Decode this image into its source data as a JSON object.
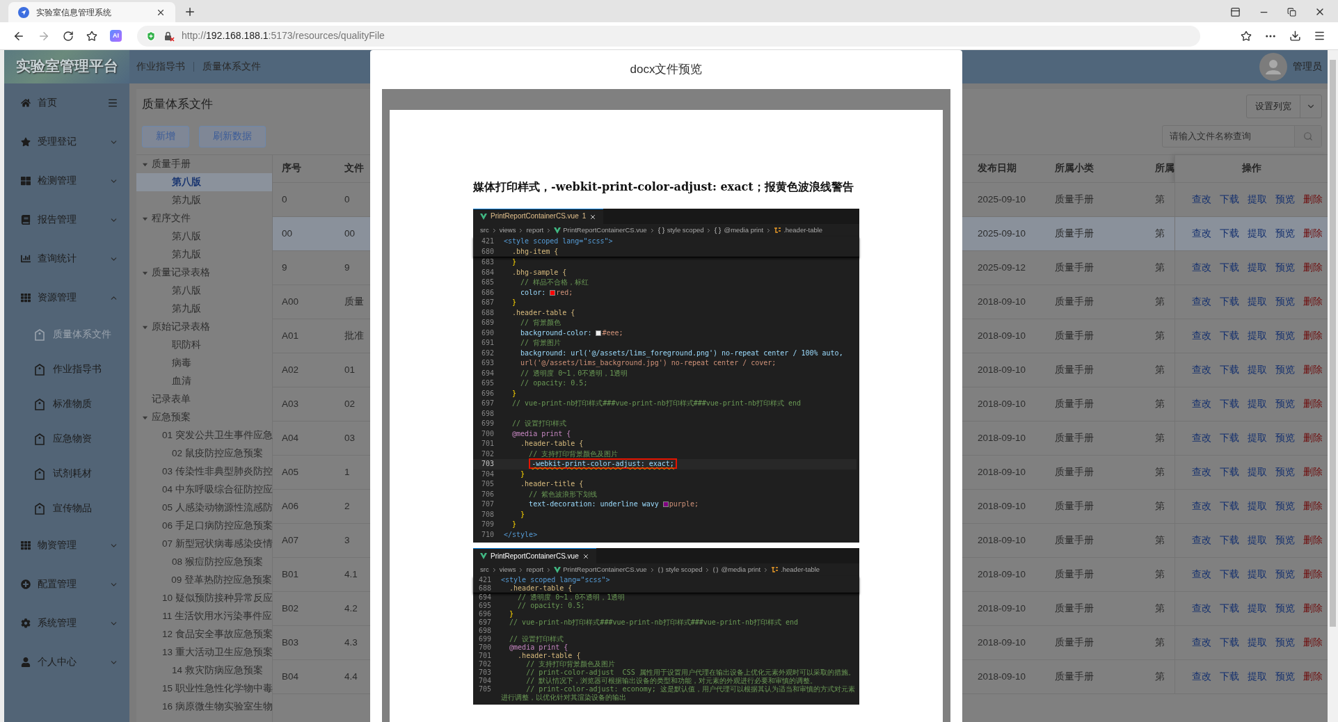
{
  "browser": {
    "tab": {
      "title": "实验室信息管理系统"
    },
    "address": {
      "scheme": "http://",
      "host": "192.168.188.1",
      "path": ":5173/resources/qualityFile"
    },
    "ai_label": "AI"
  },
  "header": {
    "logo": "实验室管理平台",
    "breadcrumb": [
      "作业指导书",
      "质量体系文件"
    ],
    "user": "管理员"
  },
  "sidebar": {
    "items": [
      {
        "label": "首页",
        "selected": false
      },
      {
        "label": "受理登记",
        "selected": false,
        "expanded": false
      },
      {
        "label": "检测管理",
        "selected": false,
        "expanded": false
      },
      {
        "label": "报告管理",
        "selected": false,
        "expanded": false
      },
      {
        "label": "查询统计",
        "selected": false,
        "expanded": false
      },
      {
        "label": "资源管理",
        "selected": false,
        "expanded": true,
        "children": [
          {
            "label": "质量体系文件",
            "selected": true
          },
          {
            "label": "作业指导书",
            "selected": false
          },
          {
            "label": "标准物质",
            "selected": false
          },
          {
            "label": "应急物资",
            "selected": false
          },
          {
            "label": "试剂耗材",
            "selected": false
          },
          {
            "label": "宣传物品",
            "selected": false
          }
        ]
      },
      {
        "label": "物资管理",
        "selected": false,
        "expanded": false
      },
      {
        "label": "配置管理",
        "selected": false,
        "expanded": false
      },
      {
        "label": "系统管理",
        "selected": false,
        "expanded": false
      },
      {
        "label": "个人中心",
        "selected": false,
        "expanded": false
      }
    ]
  },
  "page": {
    "title": "质量体系文件",
    "buttons": [
      "新增",
      "刷新数据"
    ],
    "column_button": "设置列宽",
    "search": {
      "placeholder": "请输入文件名称查询"
    }
  },
  "tree": [
    {
      "label": "质量手册",
      "selected": false,
      "expanded": true,
      "children": [
        {
          "label": "第八版",
          "selected": true
        },
        {
          "label": "第九版",
          "selected": false
        }
      ]
    },
    {
      "label": "程序文件",
      "selected": false,
      "expanded": true,
      "children": [
        {
          "label": "第八版",
          "selected": false
        },
        {
          "label": "第九版",
          "selected": false
        }
      ]
    },
    {
      "label": "质量记录表格",
      "selected": false,
      "expanded": true,
      "children": [
        {
          "label": "第八版",
          "selected": false
        },
        {
          "label": "第九版",
          "selected": false
        }
      ]
    },
    {
      "label": "原始记录表格",
      "selected": false,
      "expanded": true,
      "children": [
        {
          "label": "职防科",
          "selected": false
        },
        {
          "label": "病毒",
          "selected": false
        },
        {
          "label": "血清",
          "selected": false
        }
      ]
    },
    {
      "label": "记录表单",
      "selected": false
    },
    {
      "label": "应急预案",
      "selected": false,
      "expanded": true,
      "children": [
        {
          "label": "01 突发公共卫生事件应急",
          "selected": false
        },
        {
          "label": "02 鼠疫防控应急预案",
          "selected": false
        },
        {
          "label": "03 传染性非典型肺炎防控",
          "selected": false
        },
        {
          "label": "04 中东呼吸综合征防控应",
          "selected": false
        },
        {
          "label": "05 人感染动物源性流感防",
          "selected": false
        },
        {
          "label": "06 手足口病防控应急预案",
          "selected": false
        },
        {
          "label": "07 新型冠状病毒感染疫情",
          "selected": false
        },
        {
          "label": "08 猴痘防控应急预案",
          "selected": false
        },
        {
          "label": "09 登革热防控应急预案",
          "selected": false
        },
        {
          "label": "10 疑似预防接种异常反应",
          "selected": false
        },
        {
          "label": "11 生活饮用水污染事件应",
          "selected": false
        },
        {
          "label": "12 食品安全事故应急预案",
          "selected": false
        },
        {
          "label": "13 重大活动卫生应急预案",
          "selected": false
        },
        {
          "label": "14 救灾防病应急预案",
          "selected": false
        },
        {
          "label": "15 职业性急性化学物中毒",
          "selected": false
        },
        {
          "label": "16 病原微生物实验室生物",
          "selected": false
        }
      ]
    }
  ],
  "table": {
    "columns": [
      "序号",
      "文件",
      "发布日期",
      "所属小类",
      "所属",
      "操作"
    ],
    "rows": [
      {
        "selected": false,
        "cells": [
          "0",
          "0",
          "2025-09-10",
          "质量手册",
          "第"
        ],
        "actions": [
          {
            "label": "查改",
            "kind": "link"
          },
          {
            "label": "下载",
            "kind": "link"
          },
          {
            "label": "提取",
            "kind": "link"
          },
          {
            "label": "预览",
            "kind": "link"
          },
          {
            "label": "删除",
            "kind": "danger"
          }
        ]
      },
      {
        "selected": true,
        "cells": [
          "00",
          "00",
          "2025-09-10",
          "质量手册",
          "第"
        ],
        "actions": [
          {
            "label": "查改",
            "kind": "link"
          },
          {
            "label": "下载",
            "kind": "link"
          },
          {
            "label": "提取",
            "kind": "link"
          },
          {
            "label": "预览",
            "kind": "link"
          },
          {
            "label": "删除",
            "kind": "danger"
          }
        ]
      },
      {
        "selected": false,
        "cells": [
          "9",
          "9",
          "2025-09-12",
          "质量手册",
          "第"
        ],
        "actions": [
          {
            "label": "查改",
            "kind": "link"
          },
          {
            "label": "下载",
            "kind": "link"
          },
          {
            "label": "提取",
            "kind": "link"
          },
          {
            "label": "预览",
            "kind": "link"
          },
          {
            "label": "删除",
            "kind": "danger"
          }
        ]
      },
      {
        "selected": false,
        "cells": [
          "A00",
          "质量",
          "2018-09-10",
          "质量手册",
          "第"
        ],
        "actions": [
          {
            "label": "查改",
            "kind": "link"
          },
          {
            "label": "下载",
            "kind": "link"
          },
          {
            "label": "提取",
            "kind": "link"
          },
          {
            "label": "预览",
            "kind": "link"
          },
          {
            "label": "删除",
            "kind": "danger"
          }
        ]
      },
      {
        "selected": false,
        "cells": [
          "A01",
          "批准",
          "2018-09-10",
          "质量手册",
          "第"
        ],
        "actions": [
          {
            "label": "查改",
            "kind": "link"
          },
          {
            "label": "下载",
            "kind": "link"
          },
          {
            "label": "提取",
            "kind": "link"
          },
          {
            "label": "预览",
            "kind": "link"
          },
          {
            "label": "删除",
            "kind": "danger"
          }
        ]
      },
      {
        "selected": false,
        "cells": [
          "A02",
          "01",
          "2018-09-10",
          "质量手册",
          "第"
        ],
        "actions": [
          {
            "label": "查改",
            "kind": "link"
          },
          {
            "label": "下载",
            "kind": "link"
          },
          {
            "label": "提取",
            "kind": "link"
          },
          {
            "label": "预览",
            "kind": "link"
          },
          {
            "label": "删除",
            "kind": "danger"
          }
        ]
      },
      {
        "selected": false,
        "cells": [
          "A03",
          "02",
          "2018-09-10",
          "质量手册",
          "第"
        ],
        "actions": [
          {
            "label": "查改",
            "kind": "link"
          },
          {
            "label": "下载",
            "kind": "link"
          },
          {
            "label": "提取",
            "kind": "link"
          },
          {
            "label": "预览",
            "kind": "link"
          },
          {
            "label": "删除",
            "kind": "danger"
          }
        ]
      },
      {
        "selected": false,
        "cells": [
          "A04",
          "03",
          "2018-09-10",
          "质量手册",
          "第"
        ],
        "actions": [
          {
            "label": "查改",
            "kind": "link"
          },
          {
            "label": "下载",
            "kind": "link"
          },
          {
            "label": "提取",
            "kind": "link"
          },
          {
            "label": "预览",
            "kind": "link"
          },
          {
            "label": "删除",
            "kind": "danger"
          }
        ]
      },
      {
        "selected": false,
        "cells": [
          "A05",
          "1",
          "2018-09-10",
          "质量手册",
          "第"
        ],
        "actions": [
          {
            "label": "查改",
            "kind": "link"
          },
          {
            "label": "下载",
            "kind": "link"
          },
          {
            "label": "提取",
            "kind": "link"
          },
          {
            "label": "预览",
            "kind": "link"
          },
          {
            "label": "删除",
            "kind": "danger"
          }
        ]
      },
      {
        "selected": false,
        "cells": [
          "A06",
          "2",
          "2018-09-10",
          "质量手册",
          "第"
        ],
        "actions": [
          {
            "label": "查改",
            "kind": "link"
          },
          {
            "label": "下载",
            "kind": "link"
          },
          {
            "label": "提取",
            "kind": "link"
          },
          {
            "label": "预览",
            "kind": "link"
          },
          {
            "label": "删除",
            "kind": "danger"
          }
        ]
      },
      {
        "selected": false,
        "cells": [
          "A07",
          "3",
          "2018-09-10",
          "质量手册",
          "第"
        ],
        "actions": [
          {
            "label": "查改",
            "kind": "link"
          },
          {
            "label": "下载",
            "kind": "link"
          },
          {
            "label": "提取",
            "kind": "link"
          },
          {
            "label": "预览",
            "kind": "link"
          },
          {
            "label": "删除",
            "kind": "danger"
          }
        ]
      },
      {
        "selected": false,
        "cells": [
          "B01",
          "4.1",
          "2018-09-10",
          "质量手册",
          "第"
        ],
        "actions": [
          {
            "label": "查改",
            "kind": "link"
          },
          {
            "label": "下载",
            "kind": "link"
          },
          {
            "label": "提取",
            "kind": "link"
          },
          {
            "label": "预览",
            "kind": "link"
          },
          {
            "label": "删除",
            "kind": "danger"
          }
        ]
      },
      {
        "selected": false,
        "cells": [
          "B02",
          "4.2",
          "2018-09-10",
          "质量手册",
          "第"
        ],
        "actions": [
          {
            "label": "查改",
            "kind": "link"
          },
          {
            "label": "下载",
            "kind": "link"
          },
          {
            "label": "提取",
            "kind": "link"
          },
          {
            "label": "预览",
            "kind": "link"
          },
          {
            "label": "删除",
            "kind": "danger"
          }
        ]
      },
      {
        "selected": false,
        "cells": [
          "B03",
          "4.3",
          "2018-09-10",
          "质量手册",
          "第"
        ],
        "actions": [
          {
            "label": "查改",
            "kind": "link"
          },
          {
            "label": "下载",
            "kind": "link"
          },
          {
            "label": "提取",
            "kind": "link"
          },
          {
            "label": "预览",
            "kind": "link"
          },
          {
            "label": "删除",
            "kind": "danger"
          }
        ]
      },
      {
        "selected": false,
        "cells": [
          "B04",
          "4.4",
          "2018-09-10",
          "质量手册",
          "第"
        ],
        "actions": [
          {
            "label": "查改",
            "kind": "link"
          },
          {
            "label": "下载",
            "kind": "link"
          },
          {
            "label": "提取",
            "kind": "link"
          },
          {
            "label": "预览",
            "kind": "link"
          },
          {
            "label": "删除",
            "kind": "danger"
          }
        ]
      }
    ]
  },
  "preview": {
    "title": "docx文件预览",
    "heading": "媒体打印样式，-webkit-print-color-adjust: exact；报黄色波浪线警告",
    "images": [
      {
        "tab_label": "PrintReportContainerCS.vue",
        "tab_badge": "1",
        "breadcrumb": [
          {
            "label": "src",
            "kind": "folder"
          },
          {
            "label": "views",
            "kind": "folder"
          },
          {
            "label": "report",
            "kind": "folder"
          },
          {
            "label": "PrintReportContainerCS.vue",
            "kind": "file"
          },
          {
            "label": "style scoped",
            "kind": "braces"
          },
          {
            "label": "@media print",
            "kind": "braces"
          },
          {
            "label": ".header-table",
            "kind": "symbol"
          }
        ],
        "sticky_lines": [
          {
            "num": "421",
            "text": "<style scoped lang=\"scss\">",
            "kind": "tag"
          },
          {
            "num": "680",
            "text": "  .bhg-item {",
            "kind": "selector"
          }
        ],
        "lines": [
          {
            "num": "683",
            "text": "  }",
            "kind": "brace"
          },
          {
            "num": "684",
            "text": "  .bhg-sample {",
            "kind": "selector"
          },
          {
            "num": "685",
            "text": "    // 样品不合格，标红",
            "kind": "comment"
          },
          {
            "num": "686",
            "text": "    color: ",
            "kind": "property",
            "swatch": true,
            "rest": "red;"
          },
          {
            "num": "687",
            "text": "  }",
            "kind": "brace"
          },
          {
            "num": "688",
            "text": "  .header-table {",
            "kind": "selector"
          },
          {
            "num": "689",
            "text": "    // 背景颜色",
            "kind": "comment"
          },
          {
            "num": "690",
            "text": "    background-color: ",
            "kind": "property",
            "swatch": true,
            "rest": "#eee;"
          },
          {
            "num": "691",
            "text": "    // 背景图片",
            "kind": "comment"
          },
          {
            "num": "692",
            "text": "    background: url('@/assets/lims_foreground.png') no-repeat center / 100% auto,",
            "kind": "property"
          },
          {
            "num": "693",
            "text": "    url('@/assets/lims_background.jpg') no-repeat center / cover;",
            "kind": "value"
          },
          {
            "num": "694",
            "text": "    // 透明度 0~1，0不透明，1透明",
            "kind": "comment"
          },
          {
            "num": "695",
            "text": "    // opacity: 0.5;",
            "kind": "comment"
          },
          {
            "num": "696",
            "text": "  }",
            "kind": "brace"
          },
          {
            "num": "697",
            "text": "  // vue-print-nb打印样式###vue-print-nb打印样式###vue-print-nb打印样式 end",
            "kind": "comment"
          },
          {
            "num": "698",
            "kind": "plain"
          },
          {
            "num": "699",
            "text": "  // 设置打印样式",
            "kind": "comment"
          },
          {
            "num": "700",
            "text": "  @media print {",
            "kind": "at"
          },
          {
            "num": "701",
            "text": "    .header-table {",
            "kind": "selector"
          },
          {
            "num": "702",
            "text": "      // 支持打印背景颜色及图片",
            "kind": "comment"
          },
          {
            "num": "703",
            "text": "      -webkit-print-color-adjust: exact;",
            "kind": "boxed"
          },
          {
            "num": "704",
            "text": "    }",
            "kind": "brace"
          },
          {
            "num": "705",
            "text": "    .header-title {",
            "kind": "selector"
          },
          {
            "num": "706",
            "text": "      // 紫色波浪形下划线",
            "kind": "comment"
          },
          {
            "num": "707",
            "text": "      text-decoration: underline wavy ",
            "kind": "property",
            "swatch": true,
            "rest": "purple;"
          },
          {
            "num": "708",
            "text": "    }",
            "kind": "brace"
          },
          {
            "num": "709",
            "text": "  }",
            "kind": "brace"
          },
          {
            "num": "710",
            "text": "</style>",
            "kind": "tag"
          }
        ]
      },
      {
        "tab_label": "PrintReportContainerCS.vue",
        "breadcrumb": [
          {
            "label": "src",
            "kind": "folder"
          },
          {
            "label": "views",
            "kind": "folder"
          },
          {
            "label": "report",
            "kind": "folder"
          },
          {
            "label": "PrintReportContainerCS.vue",
            "kind": "file"
          },
          {
            "label": "style scoped",
            "kind": "braces"
          },
          {
            "label": "@media print",
            "kind": "braces"
          },
          {
            "label": ".header-table",
            "kind": "symbol"
          }
        ],
        "sticky_lines": [
          {
            "num": "421",
            "text": "<style scoped lang=\"scss\">",
            "kind": "tag"
          },
          {
            "num": "688",
            "text": "  .header-table {",
            "kind": "selector"
          }
        ],
        "lines": [
          {
            "num": "694",
            "text": "    // 透明度 0~1，0不透明，1透明",
            "kind": "comment"
          },
          {
            "num": "695",
            "text": "    // opacity: 0.5;",
            "kind": "comment"
          },
          {
            "num": "696",
            "text": "  }",
            "kind": "brace"
          },
          {
            "num": "697",
            "text": "  // vue-print-nb打印样式###vue-print-nb打印样式###vue-print-nb打印样式 end",
            "kind": "comment"
          },
          {
            "num": "698",
            "kind": "plain"
          },
          {
            "num": "699",
            "text": "  // 设置打印样式",
            "kind": "comment"
          },
          {
            "num": "700",
            "text": "  @media print {",
            "kind": "at"
          },
          {
            "num": "701",
            "text": "    .header-table {",
            "kind": "selector"
          },
          {
            "num": "702",
            "text": "      // 支持打印背景颜色及图片",
            "kind": "comment"
          },
          {
            "num": "703",
            "text": "      // print-color-adjust  CSS 属性用于设置用户代理在输出设备上优化元素外观时可以采取的措施。",
            "kind": "comment"
          },
          {
            "num": "704",
            "text": "      // 默认情况下，浏览器可根据输出设备的类型和功能，对元素的外观进行必要和审慎的调整。",
            "kind": "comment"
          },
          {
            "num": "705",
            "text": "      // print-color-adjust: economy; 这是默认值，用户代理可以根据其认为适当和审慎的方式对元素进行调整，以优化针对其渲染设备的输出",
            "kind": "comment"
          }
        ]
      }
    ]
  }
}
